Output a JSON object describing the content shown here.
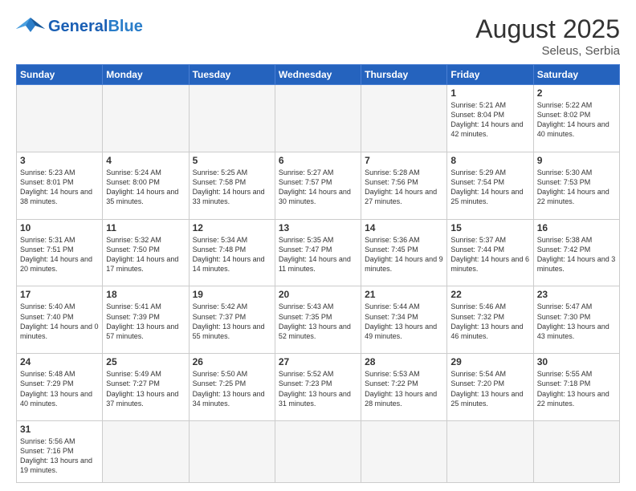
{
  "header": {
    "logo_general": "General",
    "logo_blue": "Blue",
    "month_title": "August 2025",
    "location": "Seleus, Serbia"
  },
  "weekdays": [
    "Sunday",
    "Monday",
    "Tuesday",
    "Wednesday",
    "Thursday",
    "Friday",
    "Saturday"
  ],
  "weeks": [
    [
      {
        "day": "",
        "info": ""
      },
      {
        "day": "",
        "info": ""
      },
      {
        "day": "",
        "info": ""
      },
      {
        "day": "",
        "info": ""
      },
      {
        "day": "",
        "info": ""
      },
      {
        "day": "1",
        "info": "Sunrise: 5:21 AM\nSunset: 8:04 PM\nDaylight: 14 hours and 42 minutes."
      },
      {
        "day": "2",
        "info": "Sunrise: 5:22 AM\nSunset: 8:02 PM\nDaylight: 14 hours and 40 minutes."
      }
    ],
    [
      {
        "day": "3",
        "info": "Sunrise: 5:23 AM\nSunset: 8:01 PM\nDaylight: 14 hours and 38 minutes."
      },
      {
        "day": "4",
        "info": "Sunrise: 5:24 AM\nSunset: 8:00 PM\nDaylight: 14 hours and 35 minutes."
      },
      {
        "day": "5",
        "info": "Sunrise: 5:25 AM\nSunset: 7:58 PM\nDaylight: 14 hours and 33 minutes."
      },
      {
        "day": "6",
        "info": "Sunrise: 5:27 AM\nSunset: 7:57 PM\nDaylight: 14 hours and 30 minutes."
      },
      {
        "day": "7",
        "info": "Sunrise: 5:28 AM\nSunset: 7:56 PM\nDaylight: 14 hours and 27 minutes."
      },
      {
        "day": "8",
        "info": "Sunrise: 5:29 AM\nSunset: 7:54 PM\nDaylight: 14 hours and 25 minutes."
      },
      {
        "day": "9",
        "info": "Sunrise: 5:30 AM\nSunset: 7:53 PM\nDaylight: 14 hours and 22 minutes."
      }
    ],
    [
      {
        "day": "10",
        "info": "Sunrise: 5:31 AM\nSunset: 7:51 PM\nDaylight: 14 hours and 20 minutes."
      },
      {
        "day": "11",
        "info": "Sunrise: 5:32 AM\nSunset: 7:50 PM\nDaylight: 14 hours and 17 minutes."
      },
      {
        "day": "12",
        "info": "Sunrise: 5:34 AM\nSunset: 7:48 PM\nDaylight: 14 hours and 14 minutes."
      },
      {
        "day": "13",
        "info": "Sunrise: 5:35 AM\nSunset: 7:47 PM\nDaylight: 14 hours and 11 minutes."
      },
      {
        "day": "14",
        "info": "Sunrise: 5:36 AM\nSunset: 7:45 PM\nDaylight: 14 hours and 9 minutes."
      },
      {
        "day": "15",
        "info": "Sunrise: 5:37 AM\nSunset: 7:44 PM\nDaylight: 14 hours and 6 minutes."
      },
      {
        "day": "16",
        "info": "Sunrise: 5:38 AM\nSunset: 7:42 PM\nDaylight: 14 hours and 3 minutes."
      }
    ],
    [
      {
        "day": "17",
        "info": "Sunrise: 5:40 AM\nSunset: 7:40 PM\nDaylight: 14 hours and 0 minutes."
      },
      {
        "day": "18",
        "info": "Sunrise: 5:41 AM\nSunset: 7:39 PM\nDaylight: 13 hours and 57 minutes."
      },
      {
        "day": "19",
        "info": "Sunrise: 5:42 AM\nSunset: 7:37 PM\nDaylight: 13 hours and 55 minutes."
      },
      {
        "day": "20",
        "info": "Sunrise: 5:43 AM\nSunset: 7:35 PM\nDaylight: 13 hours and 52 minutes."
      },
      {
        "day": "21",
        "info": "Sunrise: 5:44 AM\nSunset: 7:34 PM\nDaylight: 13 hours and 49 minutes."
      },
      {
        "day": "22",
        "info": "Sunrise: 5:46 AM\nSunset: 7:32 PM\nDaylight: 13 hours and 46 minutes."
      },
      {
        "day": "23",
        "info": "Sunrise: 5:47 AM\nSunset: 7:30 PM\nDaylight: 13 hours and 43 minutes."
      }
    ],
    [
      {
        "day": "24",
        "info": "Sunrise: 5:48 AM\nSunset: 7:29 PM\nDaylight: 13 hours and 40 minutes."
      },
      {
        "day": "25",
        "info": "Sunrise: 5:49 AM\nSunset: 7:27 PM\nDaylight: 13 hours and 37 minutes."
      },
      {
        "day": "26",
        "info": "Sunrise: 5:50 AM\nSunset: 7:25 PM\nDaylight: 13 hours and 34 minutes."
      },
      {
        "day": "27",
        "info": "Sunrise: 5:52 AM\nSunset: 7:23 PM\nDaylight: 13 hours and 31 minutes."
      },
      {
        "day": "28",
        "info": "Sunrise: 5:53 AM\nSunset: 7:22 PM\nDaylight: 13 hours and 28 minutes."
      },
      {
        "day": "29",
        "info": "Sunrise: 5:54 AM\nSunset: 7:20 PM\nDaylight: 13 hours and 25 minutes."
      },
      {
        "day": "30",
        "info": "Sunrise: 5:55 AM\nSunset: 7:18 PM\nDaylight: 13 hours and 22 minutes."
      }
    ],
    [
      {
        "day": "31",
        "info": "Sunrise: 5:56 AM\nSunset: 7:16 PM\nDaylight: 13 hours and 19 minutes."
      },
      {
        "day": "",
        "info": ""
      },
      {
        "day": "",
        "info": ""
      },
      {
        "day": "",
        "info": ""
      },
      {
        "day": "",
        "info": ""
      },
      {
        "day": "",
        "info": ""
      },
      {
        "day": "",
        "info": ""
      }
    ]
  ]
}
